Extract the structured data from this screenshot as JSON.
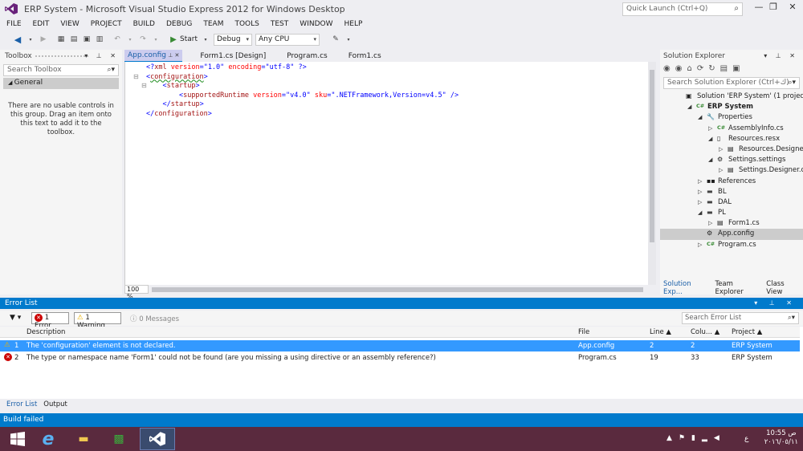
{
  "window": {
    "title": "ERP System - Microsoft Visual Studio Express 2012 for Windows Desktop",
    "quick_launch_placeholder": "Quick Launch (Ctrl+Q)"
  },
  "menu": [
    "FILE",
    "EDIT",
    "VIEW",
    "PROJECT",
    "BUILD",
    "DEBUG",
    "TEAM",
    "TOOLS",
    "TEST",
    "WINDOW",
    "HELP"
  ],
  "toolbar": {
    "start_label": "Start",
    "config_value": "Debug",
    "platform_value": "Any CPU"
  },
  "toolbox": {
    "title": "Toolbox",
    "search_placeholder": "Search Toolbox",
    "group_label": "General",
    "empty_message": "There are no usable controls in this group. Drag an item onto this text to add it to the toolbox."
  },
  "editor": {
    "tabs": [
      "App.config",
      "Form1.cs [Design]",
      "Program.cs",
      "Form1.cs"
    ],
    "active_tab": 0,
    "zoom": "100 %",
    "lines": [
      "<?xml version=\"1.0\" encoding=\"utf-8\" ?>",
      "<configuration>",
      "    <startup>",
      "        <supportedRuntime version=\"v4.0\" sku=\".NETFramework,Version=v4.5\" />",
      "    </startup>",
      "</configuration>"
    ]
  },
  "solution_explorer": {
    "title": "Solution Explorer",
    "search_placeholder": "Search Solution Explorer (Ctrl+ك)",
    "tree": [
      {
        "label": "Solution 'ERP System' (1 project)",
        "indent": 0,
        "icon": "solution-icon",
        "expander": ""
      },
      {
        "label": "ERP System",
        "indent": 1,
        "icon": "csharp-project-icon",
        "expander": "◢",
        "bold": true
      },
      {
        "label": "Properties",
        "indent": 2,
        "icon": "wrench-icon",
        "expander": "◢"
      },
      {
        "label": "AssemblyInfo.cs",
        "indent": 3,
        "icon": "csharp-file-icon",
        "expander": "▷"
      },
      {
        "label": "Resources.resx",
        "indent": 3,
        "icon": "resx-file-icon",
        "expander": "◢"
      },
      {
        "label": "Resources.Designer.cs",
        "indent": 4,
        "icon": "designer-file-icon",
        "expander": "▷"
      },
      {
        "label": "Settings.settings",
        "indent": 3,
        "icon": "settings-gear-icon",
        "expander": "◢"
      },
      {
        "label": "Settings.Designer.cs",
        "indent": 4,
        "icon": "designer-file-icon",
        "expander": "▷"
      },
      {
        "label": "References",
        "indent": 2,
        "icon": "references-icon",
        "expander": "▷"
      },
      {
        "label": "BL",
        "indent": 2,
        "icon": "folder-icon",
        "expander": "▷"
      },
      {
        "label": "DAL",
        "indent": 2,
        "icon": "folder-icon",
        "expander": "▷"
      },
      {
        "label": "PL",
        "indent": 2,
        "icon": "folder-icon",
        "expander": "◢"
      },
      {
        "label": "Form1.cs",
        "indent": 3,
        "icon": "form-file-icon",
        "expander": "▷"
      },
      {
        "label": "App.config",
        "indent": 2,
        "icon": "config-file-icon",
        "expander": "",
        "selected": true
      },
      {
        "label": "Program.cs",
        "indent": 2,
        "icon": "csharp-file-icon",
        "expander": "▷"
      }
    ],
    "bottom_tabs": [
      "Solution Exp...",
      "Team Explorer",
      "Class View"
    ]
  },
  "error_list": {
    "title": "Error List",
    "errors_filter": "1 Error",
    "warnings_filter": "1 Warning",
    "messages_filter": "0 Messages",
    "search_placeholder": "Search Error List",
    "columns": [
      "Description",
      "File",
      "Line",
      "Colu...",
      "Project"
    ],
    "rows": [
      {
        "num": "1",
        "severity": "warning",
        "description": "The 'configuration' element is not declared.",
        "file": "App.config",
        "line": "2",
        "column": "2",
        "project": "ERP System"
      },
      {
        "num": "2",
        "severity": "error",
        "description": "The type or namespace name 'Form1' could not be found (are you missing a using directive or an assembly reference?)",
        "file": "Program.cs",
        "line": "19",
        "column": "33",
        "project": "ERP System"
      }
    ],
    "bottom_tabs": [
      "Error List",
      "Output"
    ]
  },
  "status_bar": {
    "text": "Build failed"
  },
  "taskbar": {
    "time": "10:55 ص",
    "date": "٢٠١٦/٠٥/١١",
    "language": "ع"
  },
  "colors": {
    "accent": "#007acc",
    "taskbar": "#5a2a3e"
  }
}
